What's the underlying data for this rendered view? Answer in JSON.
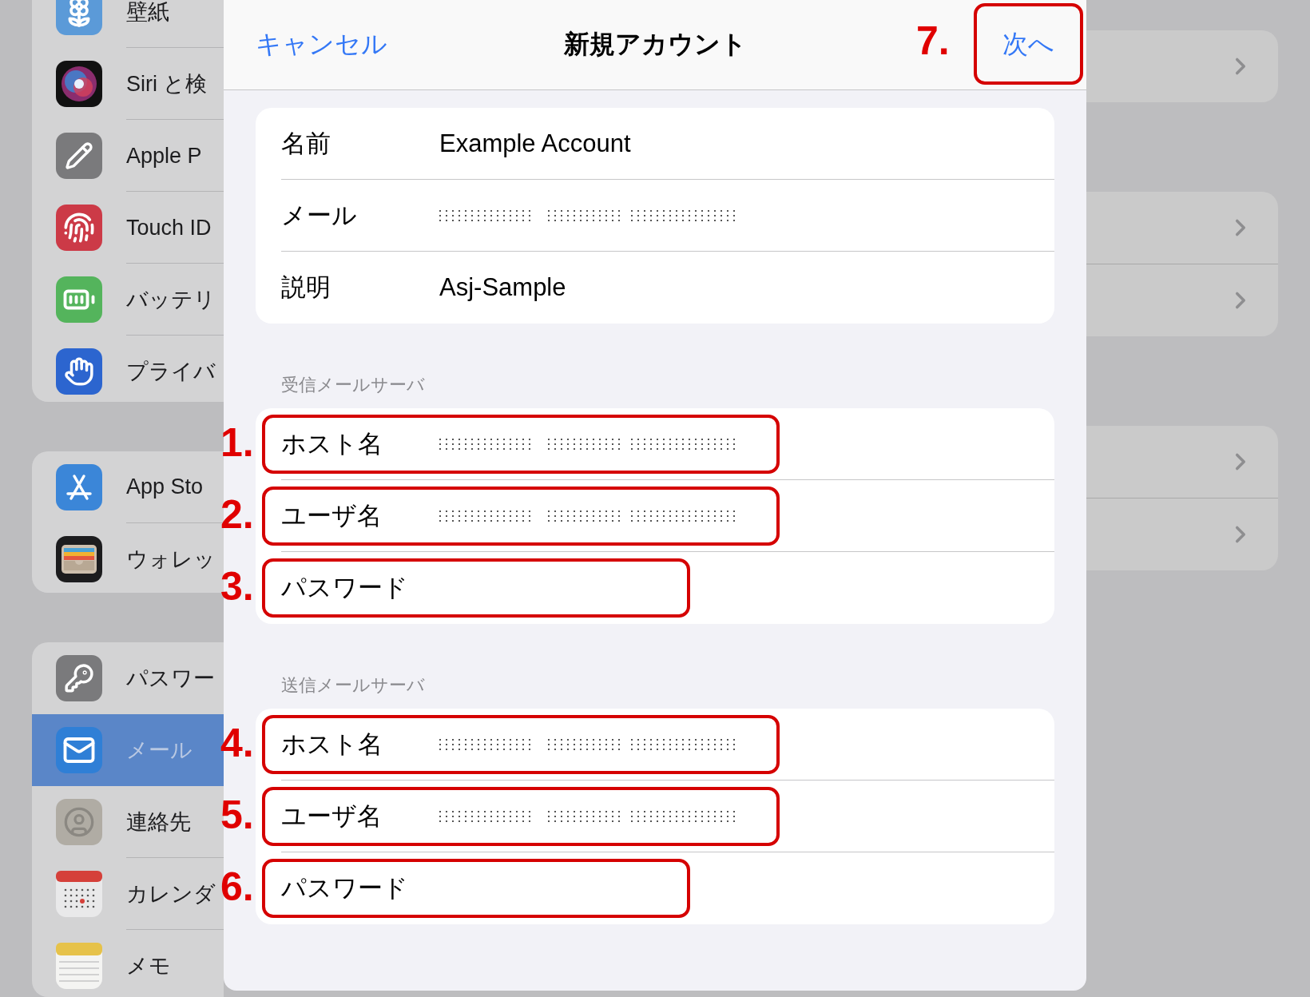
{
  "sidebar": {
    "groups": [
      {
        "items": [
          {
            "label": "壁紙",
            "selected": false
          },
          {
            "label": "Siri と検",
            "selected": false
          },
          {
            "label": "Apple P",
            "selected": false
          },
          {
            "label": "Touch ID",
            "selected": false
          },
          {
            "label": "バッテリ",
            "selected": false
          },
          {
            "label": "プライバ",
            "selected": false
          }
        ]
      },
      {
        "items": [
          {
            "label": "App Sto",
            "selected": false
          },
          {
            "label": "ウォレッ",
            "selected": false
          }
        ]
      },
      {
        "items": [
          {
            "label": "パスワー",
            "selected": false
          },
          {
            "label": "メール",
            "selected": true
          },
          {
            "label": "連絡先",
            "selected": false
          },
          {
            "label": "カレンダ",
            "selected": false
          },
          {
            "label": "メモ",
            "selected": false
          }
        ]
      }
    ]
  },
  "sheet": {
    "cancel": "キャンセル",
    "title": "新規アカウント",
    "next": "次へ",
    "next_callout": "7.",
    "sections": [
      {
        "rows": [
          {
            "label": "名前",
            "value": "Example Account",
            "masked": false
          },
          {
            "label": "メール",
            "masked": true
          },
          {
            "label": "説明",
            "value": "Asj-Sample",
            "masked": false
          }
        ]
      },
      {
        "header": "受信メールサーバ",
        "rows": [
          {
            "label": "ホスト名",
            "masked": true,
            "callout": "1."
          },
          {
            "label": "ユーザ名",
            "masked": true,
            "callout": "2."
          },
          {
            "label": "パスワード",
            "callout": "3."
          }
        ]
      },
      {
        "header": "送信メールサーバ",
        "rows": [
          {
            "label": "ホスト名",
            "masked": true,
            "callout": "4."
          },
          {
            "label": "ユーザ名",
            "masked": true,
            "callout": "5."
          },
          {
            "label": "パスワード",
            "callout": "6."
          }
        ]
      }
    ]
  }
}
